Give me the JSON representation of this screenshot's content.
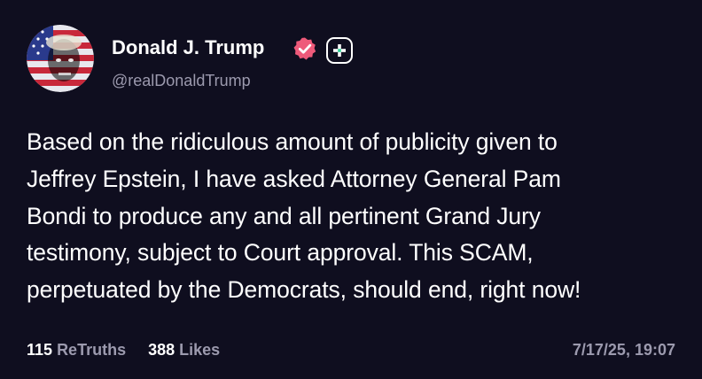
{
  "author": {
    "name": "Donald J. Trump",
    "handle": "@realDonaldTrump",
    "avatar_icon": "profile-avatar",
    "verified_icon": "verified-badge-icon",
    "verified_color": "#ee5a7a",
    "badge_icon": "plus-badge-icon"
  },
  "post": {
    "lines": [
      "Based on the ridiculous amount of publicity given to",
      "Jeffrey Epstein, I have asked Attorney General Pam",
      "Bondi to produce any and all pertinent Grand Jury",
      "testimony, subject to Court approval. This SCAM,",
      "perpetuated by the Democrats, should end, right now!"
    ]
  },
  "stats": {
    "retruths_count": "115",
    "retruths_label": "ReTruths",
    "likes_count": "388",
    "likes_label": "Likes"
  },
  "timestamp": "7/17/25, 19:07",
  "colors": {
    "background": "#0f0e1f",
    "text": "#ffffff",
    "muted": "#9c9aae"
  }
}
